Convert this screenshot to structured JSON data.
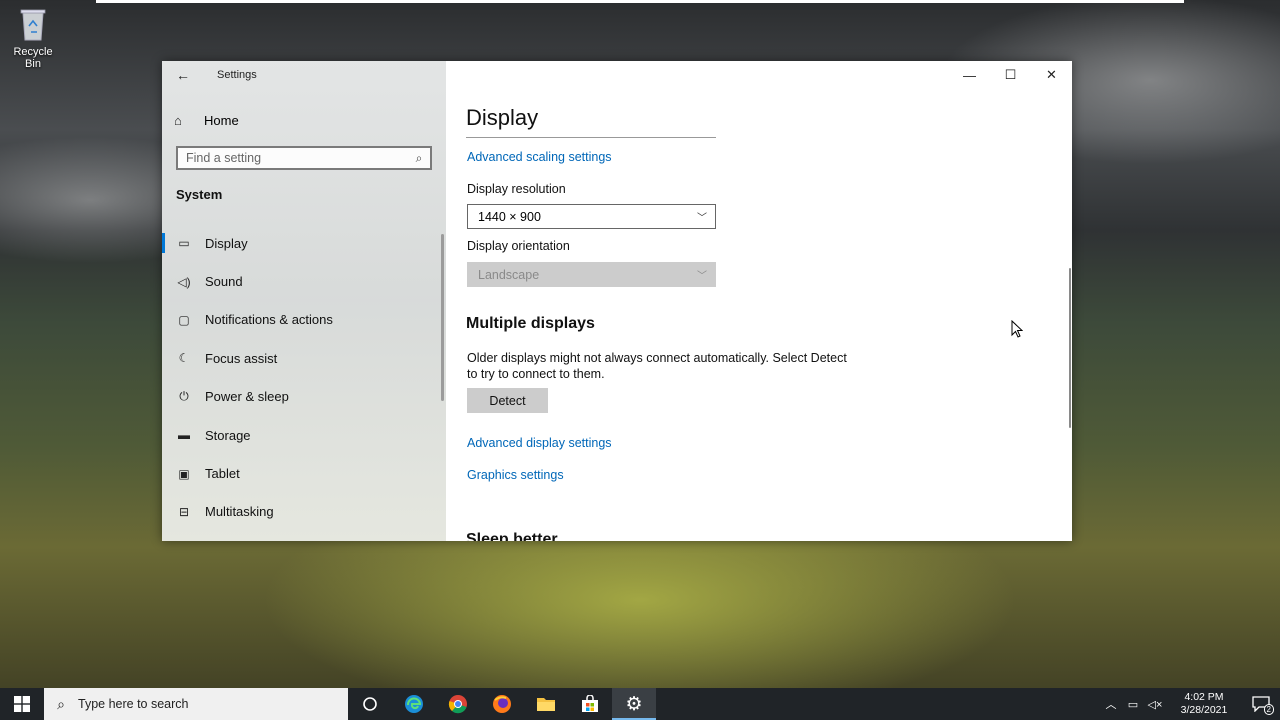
{
  "desktop": {
    "icons": [
      {
        "label": "Recycle Bin",
        "icon": "recycle-bin-icon"
      }
    ]
  },
  "window": {
    "app_title": "Settings",
    "back_icon": "back-arrow-icon",
    "controls": {
      "minimize": "minimize-icon",
      "maximize": "maximize-icon",
      "close": "close-icon"
    }
  },
  "sidebar": {
    "home_label": "Home",
    "search_placeholder": "Find a setting",
    "section_title": "System",
    "items": [
      {
        "label": "Display",
        "icon": "monitor-icon",
        "active": true
      },
      {
        "label": "Sound",
        "icon": "speaker-icon"
      },
      {
        "label": "Notifications & actions",
        "icon": "notification-icon"
      },
      {
        "label": "Focus assist",
        "icon": "moon-icon"
      },
      {
        "label": "Power & sleep",
        "icon": "power-icon"
      },
      {
        "label": "Storage",
        "icon": "storage-icon"
      },
      {
        "label": "Tablet",
        "icon": "tablet-icon"
      },
      {
        "label": "Multitasking",
        "icon": "multitasking-icon"
      }
    ]
  },
  "content": {
    "title": "Display",
    "advanced_scaling_link": "Advanced scaling settings",
    "resolution": {
      "label": "Display resolution",
      "value": "1440 × 900"
    },
    "orientation": {
      "label": "Display orientation",
      "value": "Landscape",
      "disabled": true
    },
    "multiple_displays": {
      "heading": "Multiple displays",
      "description": "Older displays might not always connect automatically. Select Detect to try to connect to them.",
      "detect_button": "Detect"
    },
    "advanced_display_link": "Advanced display settings",
    "graphics_link": "Graphics settings",
    "next_heading_partial": "Sleep better"
  },
  "taskbar": {
    "search_placeholder": "Type here to search",
    "apps": [
      {
        "name": "task-view",
        "icon": "task-view-icon"
      },
      {
        "name": "edge",
        "icon": "edge-icon"
      },
      {
        "name": "chrome",
        "icon": "chrome-icon"
      },
      {
        "name": "firefox",
        "icon": "firefox-icon"
      },
      {
        "name": "file-explorer",
        "icon": "folder-icon"
      },
      {
        "name": "store",
        "icon": "store-icon"
      },
      {
        "name": "settings",
        "icon": "gear-icon",
        "active": true
      }
    ],
    "time": "4:02 PM",
    "date": "3/28/2021",
    "notification_count": "2"
  }
}
